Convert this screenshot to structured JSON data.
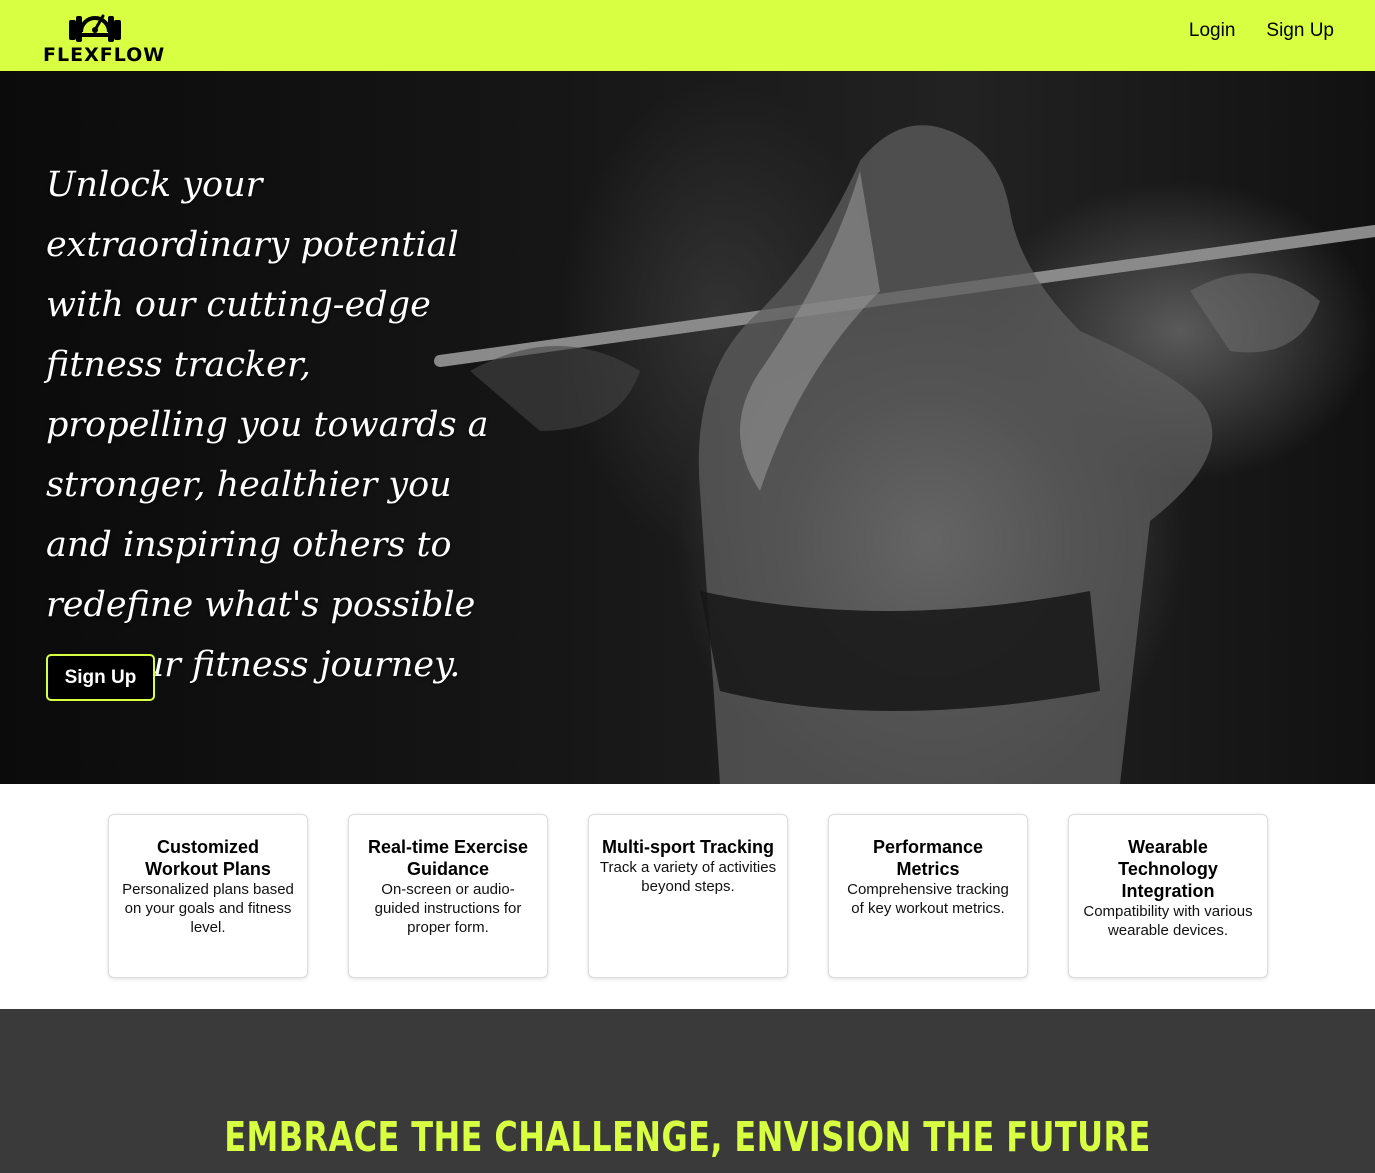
{
  "header": {
    "logo_text": "FLEXFLOW",
    "logo_icon": "dumbbell-gauge-icon",
    "nav": {
      "login": "Login",
      "signup": "Sign Up"
    }
  },
  "hero": {
    "text": "Unlock your extraordinary potential with our cutting-edge fitness tracker, propelling you towards a stronger, healthier you and inspiring others to redefine what's possible on your fitness journey.",
    "button": "Sign Up"
  },
  "features": [
    {
      "title": "Customized Workout Plans",
      "desc": "Personalized plans based on your goals and fitness level."
    },
    {
      "title": "Real-time Exercise Guidance",
      "desc": "On-screen or audio-guided instructions for proper form."
    },
    {
      "title": "Multi-sport Tracking",
      "desc": "Track a variety of activities beyond steps."
    },
    {
      "title": "Performance Metrics",
      "desc": "Comprehensive tracking of key workout metrics."
    },
    {
      "title": "Wearable Technology Integration",
      "desc": "Compatibility with various wearable devices."
    }
  ],
  "band": {
    "title": "EMBRACE THE CHALLENGE, ENVISION THE FUTURE"
  },
  "colors": {
    "accent": "#d8ff41",
    "dark_band": "#3a3a3a",
    "hero_bg": "#111111"
  }
}
